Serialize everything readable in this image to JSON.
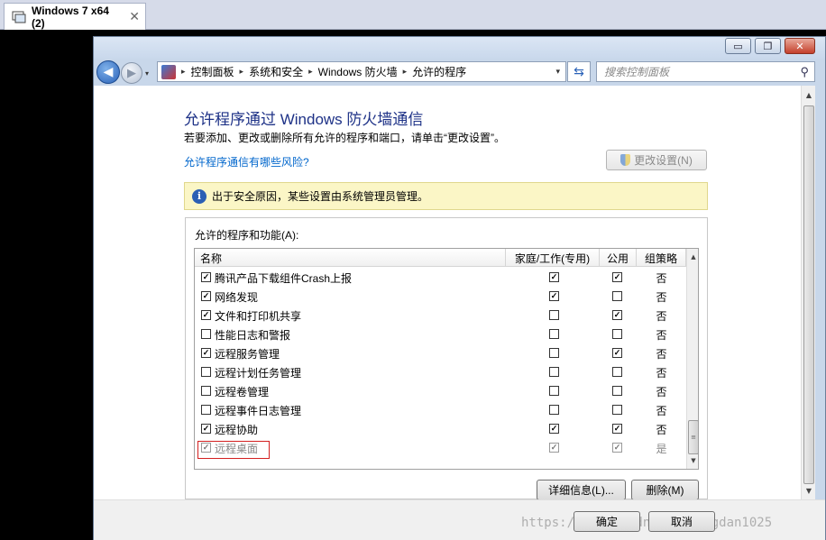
{
  "host_tab": {
    "title": "Windows 7 x64 (2)",
    "close": "✕"
  },
  "window_controls": {
    "minimize": "▭",
    "maximize": "❐",
    "close": "✕"
  },
  "nav": {
    "back": "◀",
    "forward": "▶",
    "dropdown": "▾",
    "refresh": "⇆"
  },
  "breadcrumb": [
    "控制面板",
    "系统和安全",
    "Windows 防火墙",
    "允许的程序"
  ],
  "breadcrumb_separator": "▸",
  "search": {
    "placeholder": "搜索控制面板",
    "icon": "magnifier"
  },
  "main": {
    "heading": "允许程序通过 Windows 防火墙通信",
    "subtext": "若要添加、更改或删除所有允许的程序和端口，请单击“更改设置”。",
    "risk_link": "允许程序通信有哪些风险?",
    "change_settings": "更改设置(N)",
    "info_text": "出于安全原因，某些设置由系统管理员管理。",
    "info_icon": "i",
    "group_label": "允许的程序和功能(A):",
    "columns": [
      "名称",
      "家庭/工作(专用)",
      "公用",
      "组策略"
    ],
    "rows": [
      {
        "name": "腾讯产品下载组件Crash上报",
        "enabled": true,
        "home": true,
        "public": true,
        "policy": "否"
      },
      {
        "name": "网络发现",
        "enabled": true,
        "home": true,
        "public": false,
        "policy": "否"
      },
      {
        "name": "文件和打印机共享",
        "enabled": true,
        "home": false,
        "public": true,
        "policy": "否"
      },
      {
        "name": "性能日志和警报",
        "enabled": false,
        "home": false,
        "public": false,
        "policy": "否"
      },
      {
        "name": "远程服务管理",
        "enabled": true,
        "home": false,
        "public": true,
        "policy": "否"
      },
      {
        "name": "远程计划任务管理",
        "enabled": false,
        "home": false,
        "public": false,
        "policy": "否"
      },
      {
        "name": "远程卷管理",
        "enabled": false,
        "home": false,
        "public": false,
        "policy": "否"
      },
      {
        "name": "远程事件日志管理",
        "enabled": false,
        "home": false,
        "public": false,
        "policy": "否"
      },
      {
        "name": "远程协助",
        "enabled": true,
        "home": true,
        "public": true,
        "policy": "否"
      },
      {
        "name": "远程桌面",
        "enabled": true,
        "home": true,
        "public": true,
        "policy": "是",
        "disabled": true
      }
    ],
    "details_button": "详细信息(L)...",
    "remove_button": "删除(M)"
  },
  "footer": {
    "ok": "确定",
    "cancel": "取消",
    "watermark": "https://blog.csdn.net/yangdan1025"
  }
}
